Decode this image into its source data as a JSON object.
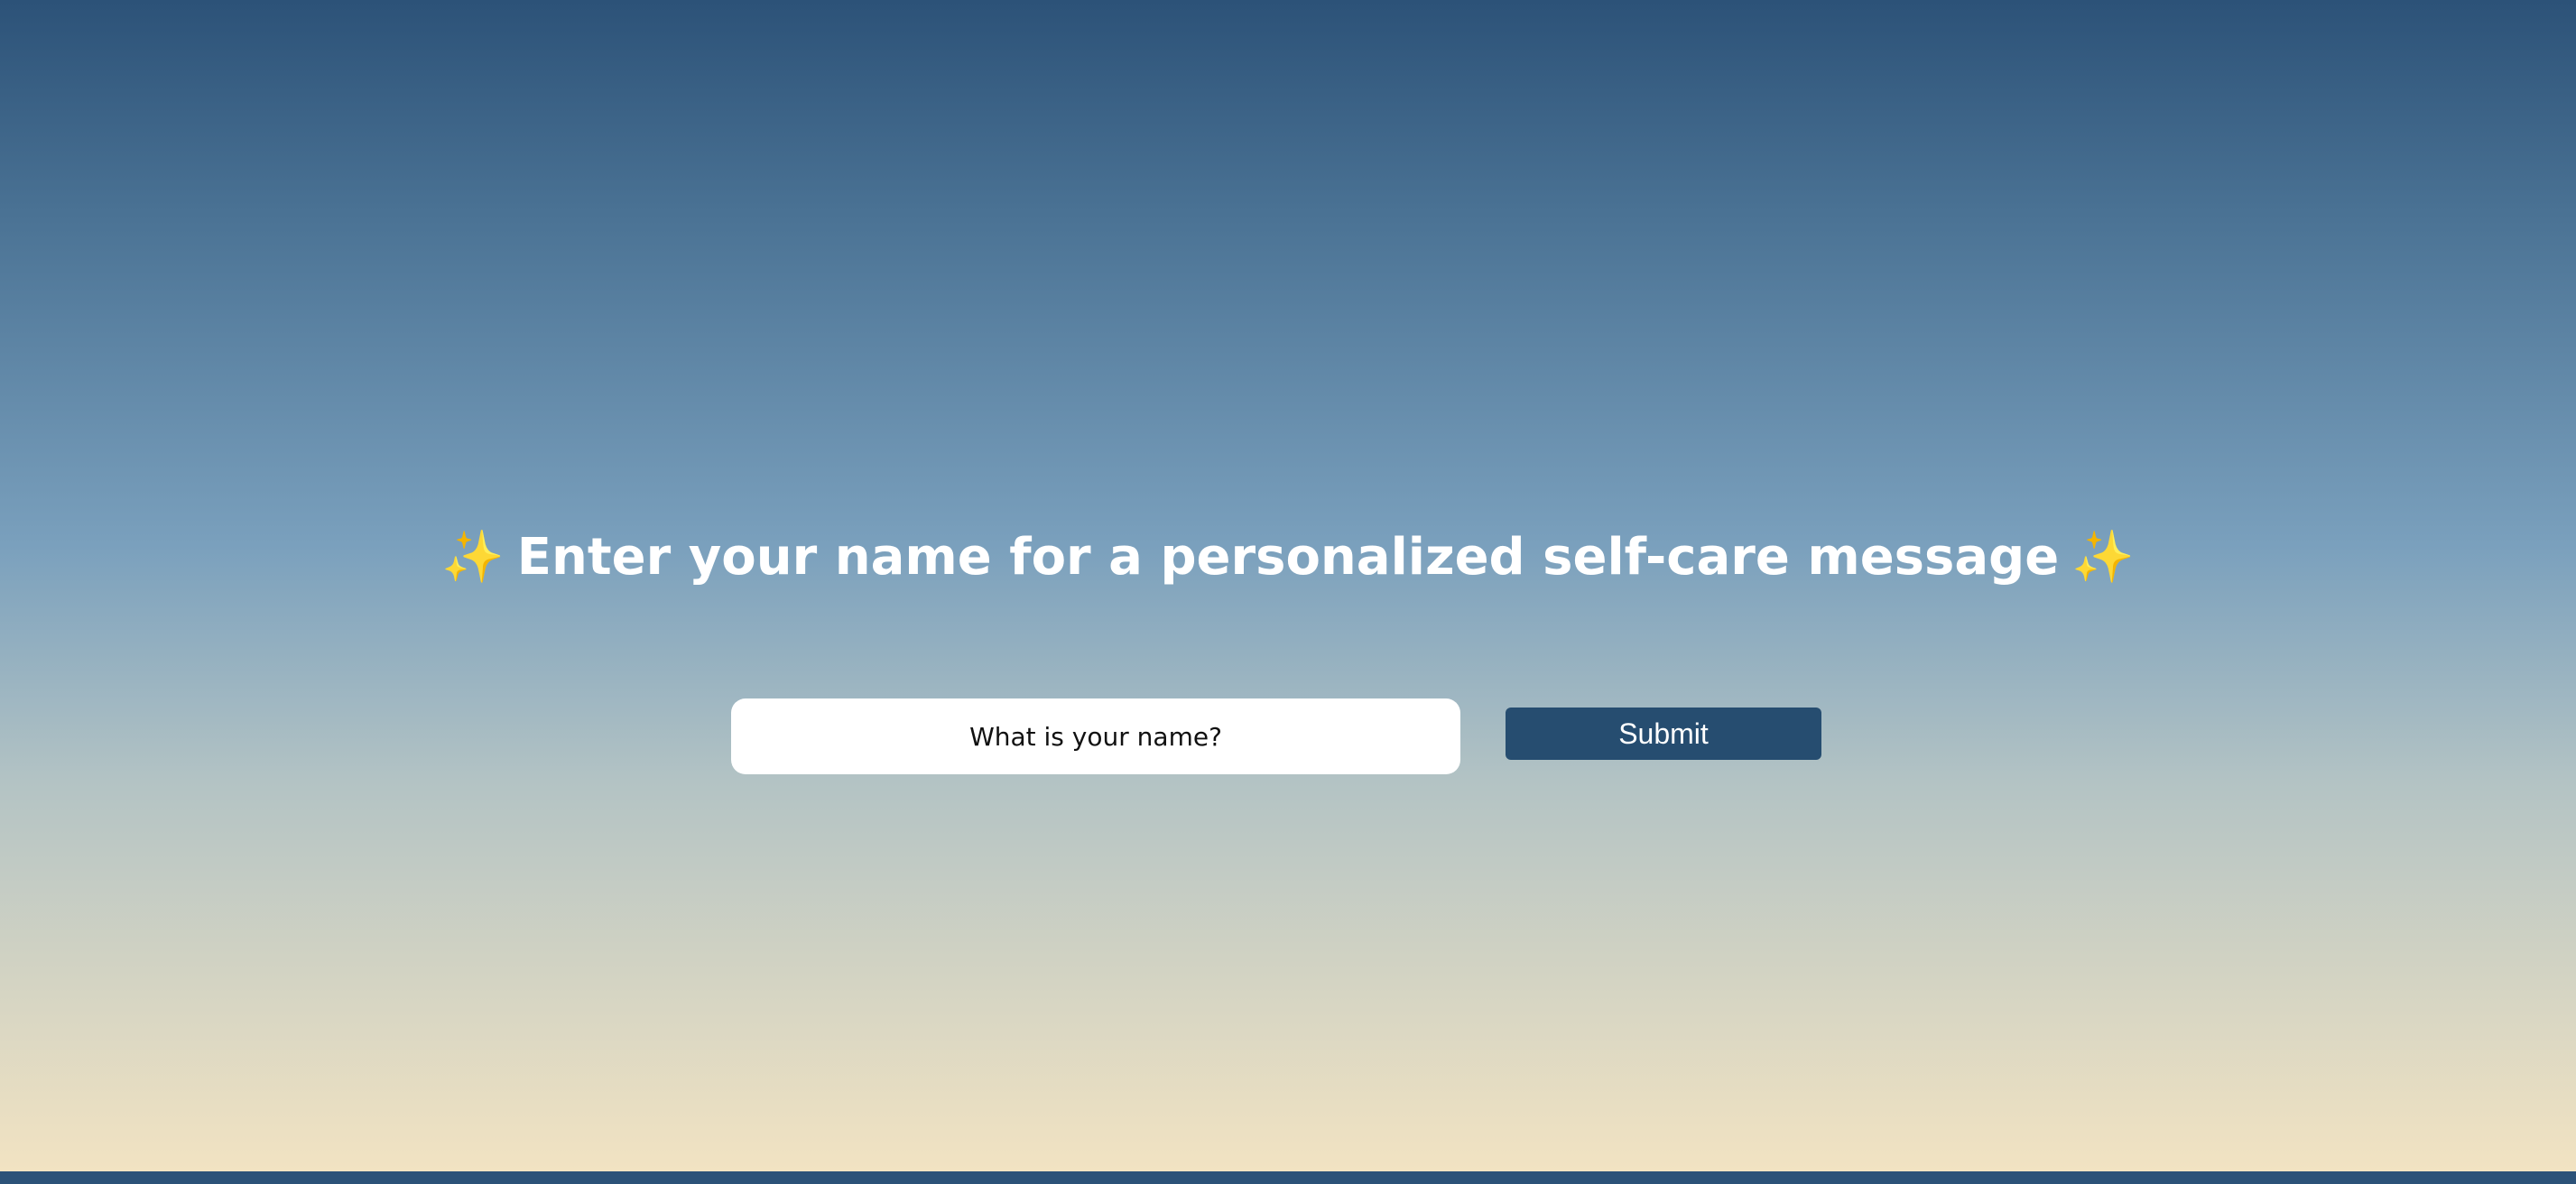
{
  "heading": {
    "sparkle": "✨",
    "text": "Enter your name for a personalized self-care message"
  },
  "form": {
    "name_placeholder": "What is your name?",
    "name_value": "",
    "submit_label": "Submit"
  },
  "colors": {
    "gradient_top": "#2c5278",
    "gradient_bottom": "#f4e4c2",
    "button": "#264d70",
    "sparkle": "#f7c948"
  },
  "icons": {
    "sparkle": "sparkles-icon"
  }
}
